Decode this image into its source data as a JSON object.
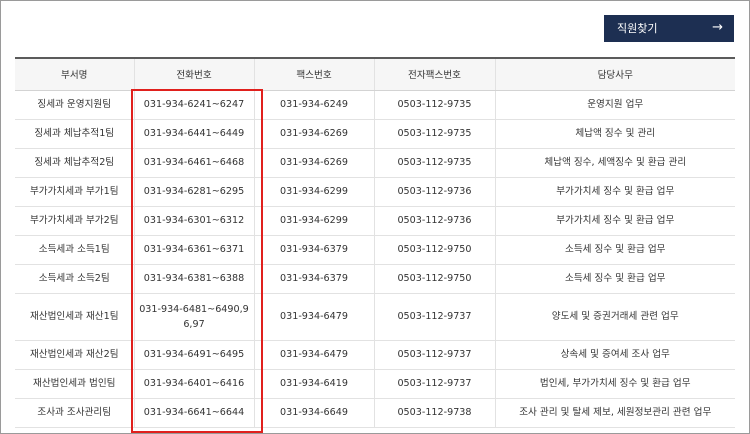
{
  "find_staff": {
    "label": "직원찾기",
    "arrow": "→"
  },
  "table": {
    "headers": [
      "부서명",
      "전화번호",
      "팩스번호",
      "전자팩스번호",
      "담당사무"
    ],
    "rows": [
      {
        "dept": "징세과 운영지원팀",
        "phone": "031-934-6241~6247",
        "fax": "031-934-6249",
        "efax": "0503-112-9735",
        "duty": "운영지원 업무"
      },
      {
        "dept": "징세과 체납추적1팀",
        "phone": "031-934-6441~6449",
        "fax": "031-934-6269",
        "efax": "0503-112-9735",
        "duty": "체납액 징수 및 관리"
      },
      {
        "dept": "징세과 체납추적2팀",
        "phone": "031-934-6461~6468",
        "fax": "031-934-6269",
        "efax": "0503-112-9735",
        "duty": "체납액 징수, 세액징수 및 환급 관리"
      },
      {
        "dept": "부가가치세과 부가1팀",
        "phone": "031-934-6281~6295",
        "fax": "031-934-6299",
        "efax": "0503-112-9736",
        "duty": "부가가치세 징수 및 환급 업무"
      },
      {
        "dept": "부가가치세과 부가2팀",
        "phone": "031-934-6301~6312",
        "fax": "031-934-6299",
        "efax": "0503-112-9736",
        "duty": "부가가치세 징수 및 환급 업무"
      },
      {
        "dept": "소득세과 소득1팀",
        "phone": "031-934-6361~6371",
        "fax": "031-934-6379",
        "efax": "0503-112-9750",
        "duty": "소득세 징수 및 환급 업무"
      },
      {
        "dept": "소득세과 소득2팀",
        "phone": "031-934-6381~6388",
        "fax": "031-934-6379",
        "efax": "0503-112-9750",
        "duty": "소득세 징수 및 환급 업무"
      },
      {
        "dept": "재산법인세과 재산1팀",
        "phone": "031-934-6481~6490,96,97",
        "fax": "031-934-6479",
        "efax": "0503-112-9737",
        "duty": "양도세 및 증권거래세 관련 업무"
      },
      {
        "dept": "재산법인세과 재산2팀",
        "phone": "031-934-6491~6495",
        "fax": "031-934-6479",
        "efax": "0503-112-9737",
        "duty": "상속세 및 증여세 조사 업무"
      },
      {
        "dept": "재산법인세과 법인팀",
        "phone": "031-934-6401~6416",
        "fax": "031-934-6419",
        "efax": "0503-112-9737",
        "duty": "법인세, 부가가치세 징수 및 환급 업무"
      },
      {
        "dept": "조사과 조사관리팀",
        "phone": "031-934-6641~6644",
        "fax": "031-934-6649",
        "efax": "0503-112-9738",
        "duty": "조사 관리 및 탈세 제보, 세원정보관리 관련 업무"
      }
    ]
  },
  "colors": {
    "button_bg": "#1d2f52",
    "highlight_border": "#e0201d",
    "header_bg": "#f6f6f6"
  }
}
